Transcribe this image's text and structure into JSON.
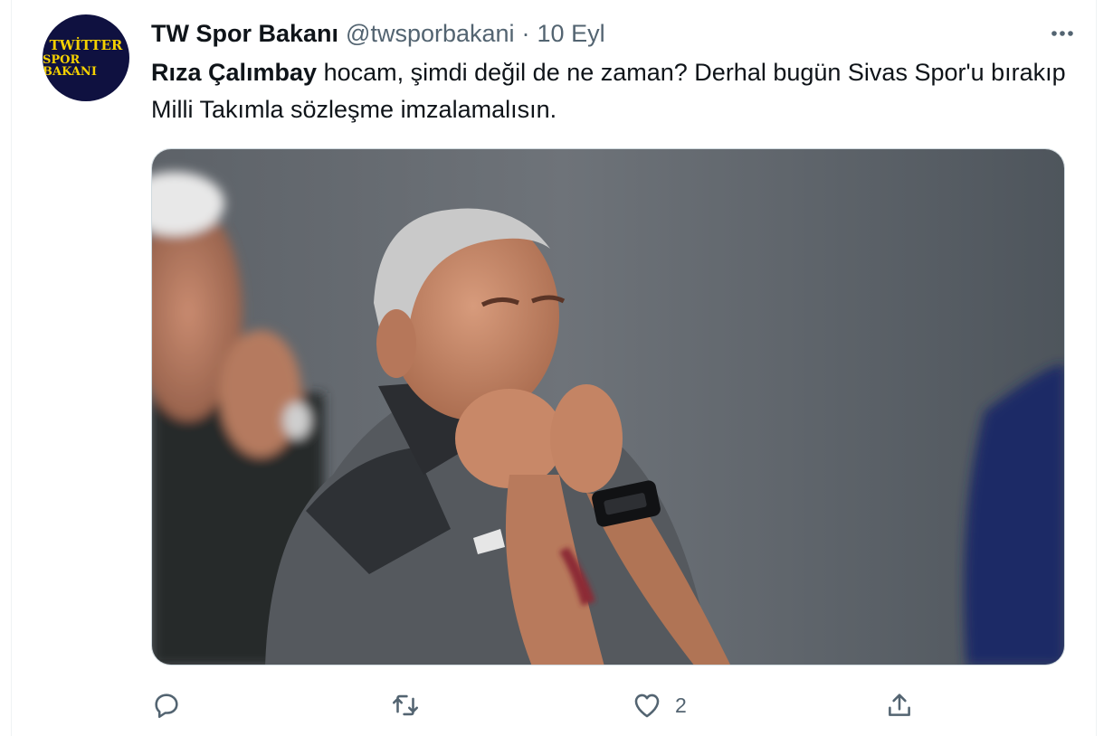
{
  "tweet": {
    "avatar": {
      "logo_line1": "TWİTTER",
      "logo_line2": "SPOR BAKANI"
    },
    "display_name": "TW Spor Bakanı",
    "handle": "@twsporbakani",
    "separator": "·",
    "date": "10 Eyl",
    "text": {
      "mention": "Rıza Çalımbay",
      "body": " hocam, şimdi değil de ne zaman? Derhal bugün Sivas Spor'u bırakıp Milli Takımla sözleşme imzalamalısın."
    },
    "actions": {
      "reply_count": "",
      "retweet_count": "",
      "like_count": "2",
      "share_count": ""
    }
  },
  "icons": {
    "more": "more-horizontal-icon",
    "reply": "reply-icon",
    "retweet": "retweet-icon",
    "like": "heart-icon",
    "share": "share-icon"
  },
  "colors": {
    "text_primary": "#0f1419",
    "text_secondary": "#536471",
    "avatar_bg": "#0f1140",
    "avatar_text": "#f5d100"
  }
}
